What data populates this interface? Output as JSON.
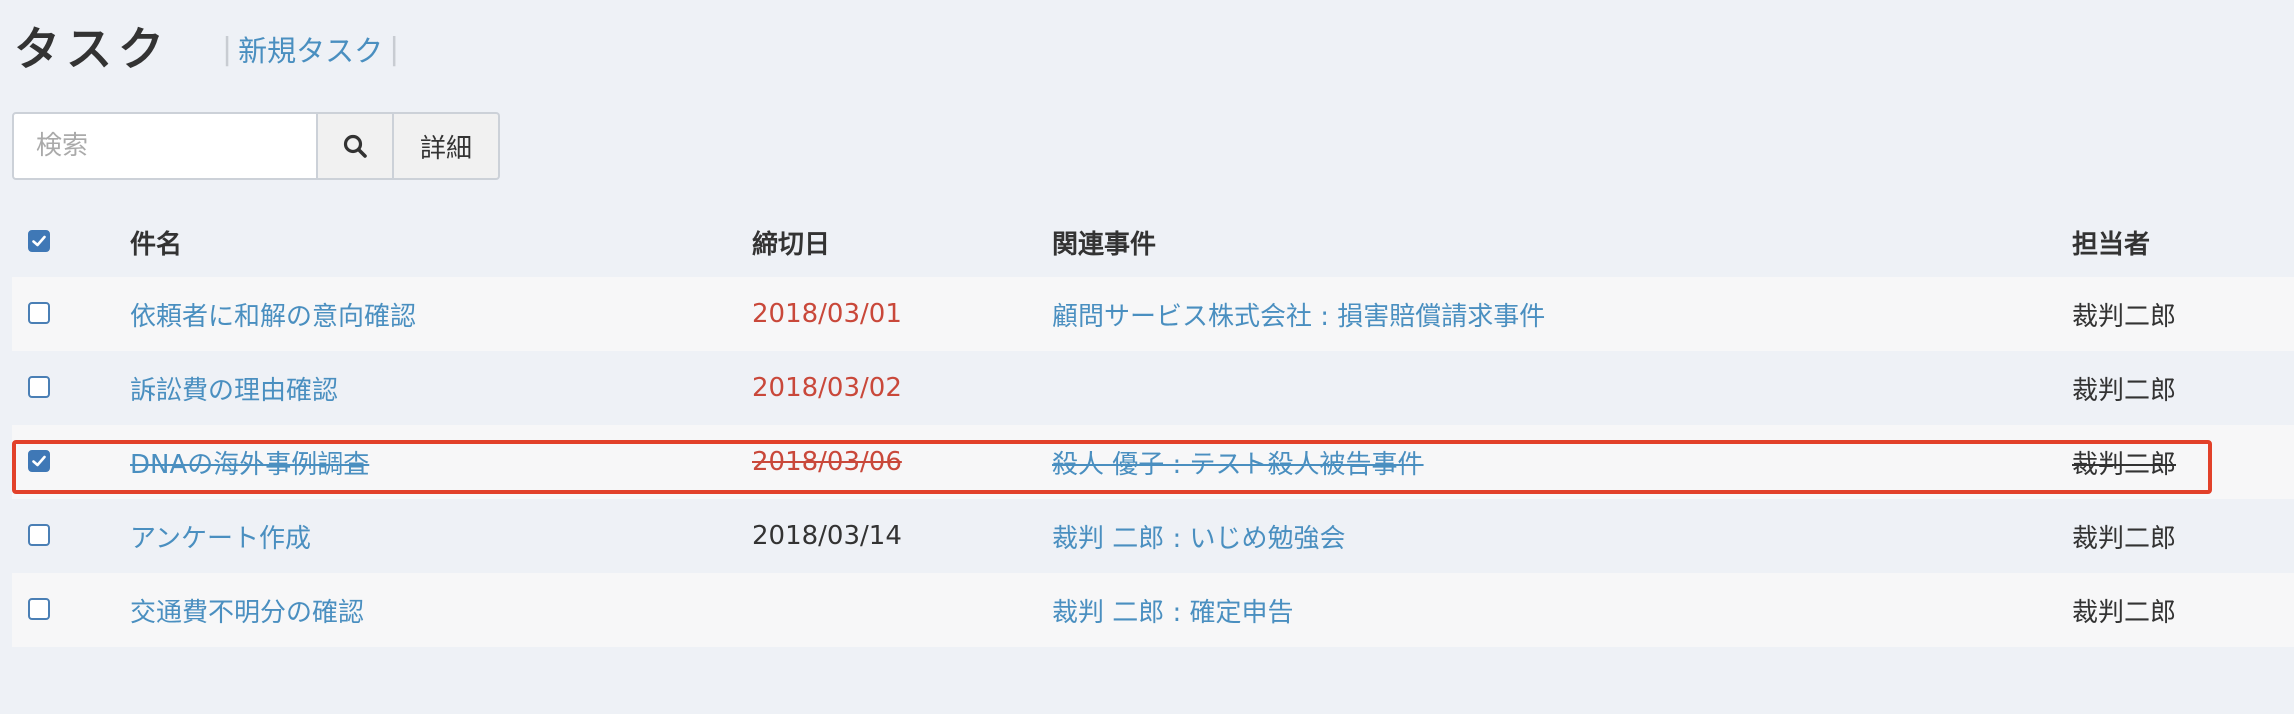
{
  "header": {
    "title": "タスク",
    "new_task_label": "新規タスク",
    "pipe": "|"
  },
  "search": {
    "placeholder": "検索",
    "search_icon": "search-icon",
    "detail_label": "詳細"
  },
  "table": {
    "columns": {
      "name": "件名",
      "due": "締切日",
      "case": "関連事件",
      "owner": "担当者"
    },
    "select_all_checked": true,
    "rows": [
      {
        "checked": false,
        "name": "依頼者に和解の意向確認",
        "due": "2018/03/01",
        "due_status": "overdue",
        "case": "顧問サービス株式会社 : 損害賠償請求事件",
        "owner": "裁判二郎",
        "done": false
      },
      {
        "checked": false,
        "name": "訴訟費の理由確認",
        "due": "2018/03/02",
        "due_status": "overdue",
        "case": "",
        "owner": "裁判二郎",
        "done": false
      },
      {
        "checked": true,
        "name": "DNAの海外事例調査",
        "due": "2018/03/06",
        "due_status": "overdue",
        "case": "殺人 優子 : テスト殺人被告事件",
        "owner": "裁判二郎",
        "done": true
      },
      {
        "checked": false,
        "name": "アンケート作成",
        "due": "2018/03/14",
        "due_status": "normal",
        "case": "裁判 二郎 : いじめ勉強会",
        "owner": "裁判二郎",
        "done": false
      },
      {
        "checked": false,
        "name": "交通費不明分の確認",
        "due": "",
        "due_status": "normal",
        "case": "裁判 二郎 : 確定申告",
        "owner": "裁判二郎",
        "done": false
      }
    ]
  },
  "colors": {
    "link": "#4a8fc0",
    "overdue": "#c9483a",
    "highlight": "#e2412a",
    "checkbox": "#3f78b6"
  }
}
